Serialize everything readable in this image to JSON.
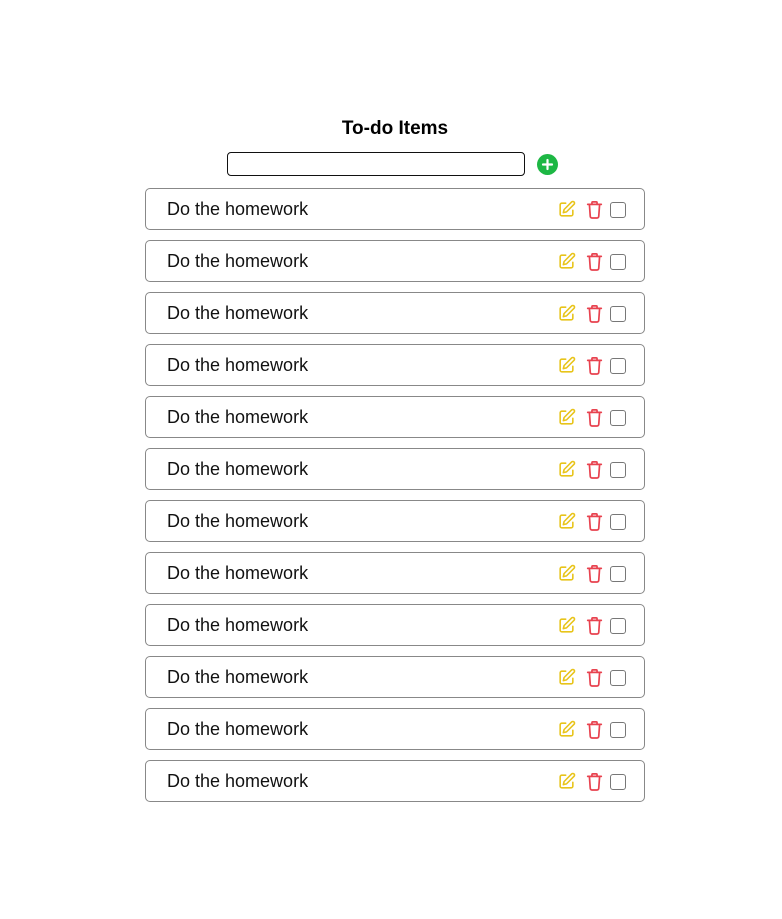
{
  "header": {
    "title": "To-do Items"
  },
  "add_form": {
    "input_value": "",
    "input_placeholder": "",
    "add_icon": "plus-circle-icon",
    "add_color": "#1db744"
  },
  "colors": {
    "edit": "#e8c41a",
    "delete": "#e8424f",
    "checkbox_border": "#777777"
  },
  "items": [
    {
      "text": "Do the homework",
      "done": false
    },
    {
      "text": "Do the homework",
      "done": false
    },
    {
      "text": "Do the homework",
      "done": false
    },
    {
      "text": "Do the homework",
      "done": false
    },
    {
      "text": "Do the homework",
      "done": false
    },
    {
      "text": "Do the homework",
      "done": false
    },
    {
      "text": "Do the homework",
      "done": false
    },
    {
      "text": "Do the homework",
      "done": false
    },
    {
      "text": "Do the homework",
      "done": false
    },
    {
      "text": "Do the homework",
      "done": false
    },
    {
      "text": "Do the homework",
      "done": false
    },
    {
      "text": "Do the homework",
      "done": false
    }
  ]
}
